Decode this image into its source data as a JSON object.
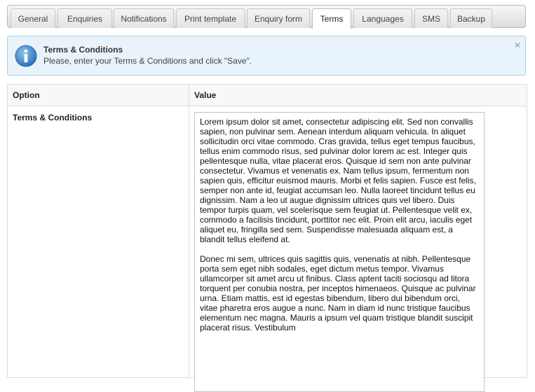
{
  "tabs": [
    {
      "label": "General",
      "active": false
    },
    {
      "label": "Enquiries",
      "active": false
    },
    {
      "label": "Notifications",
      "active": false
    },
    {
      "label": "Print template",
      "active": false
    },
    {
      "label": "Enquiry form",
      "active": false
    },
    {
      "label": "Terms",
      "active": true
    },
    {
      "label": "Languages",
      "active": false
    },
    {
      "label": "SMS",
      "active": false
    },
    {
      "label": "Backup",
      "active": false
    }
  ],
  "info": {
    "icon": "info-icon",
    "title": "Terms & Conditions",
    "text": "Please, enter your Terms & Conditions and click \"Save\".",
    "close": "×"
  },
  "table": {
    "col_option": "Option",
    "col_value": "Value",
    "row_label": "Terms & Conditions",
    "terms_paragraphs": [
      "Lorem ipsum dolor sit amet, consectetur adipiscing elit. Sed non convallis sapien, non pulvinar sem. Aenean interdum aliquam vehicula. In aliquet sollicitudin orci vitae commodo. Cras gravida, tellus eget tempus faucibus, tellus enim commodo risus, sed pulvinar dolor lorem ac est. Integer quis pellentesque nulla, vitae placerat eros. Quisque id sem non ante pulvinar consectetur. Vivamus et venenatis ex. Nam tellus ipsum, fermentum non sapien quis, efficitur euismod mauris. Morbi et felis sapien. Fusce est felis, semper non ante id, feugiat accumsan leo. Nulla laoreet tincidunt tellus eu dignissim. Nam a leo ut augue dignissim ultrices quis vel libero. Duis tempor turpis quam, vel scelerisque sem feugiat ut. Pellentesque velit ex, commodo a facilisis tincidunt, porttitor nec elit. Proin elit arcu, iaculis eget aliquet eu, fringilla sed sem. Suspendisse malesuada aliquam est, a blandit tellus eleifend at.",
      "Donec mi sem, ultrices quis sagittis quis, venenatis at nibh. Pellentesque porta sem eget nibh sodales, eget dictum metus tempor. Vivamus ullamcorper sit amet arcu ut finibus. Class aptent taciti sociosqu ad litora torquent per conubia nostra, per inceptos himenaeos. Quisque ac pulvinar urna. Etiam mattis, est id egestas bibendum, libero dui bibendum orci, vitae pharetra eros augue a nunc. Nam in diam id nunc tristique faucibus elementum nec magna. Mauris a ipsum vel quam tristique blandit suscipit placerat risus. Vestibulum"
    ]
  },
  "colors": {
    "info_bg": "#e8f3fb",
    "info_border": "#a8d0e8",
    "info_icon": "#3f86c7"
  }
}
